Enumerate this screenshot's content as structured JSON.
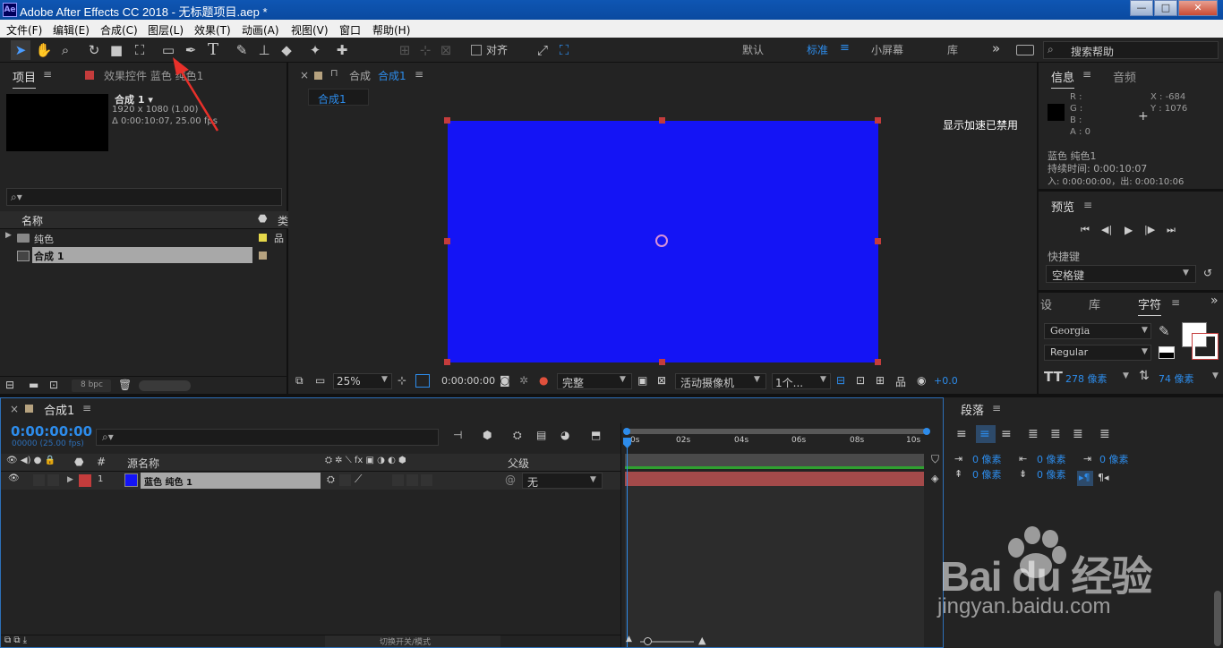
{
  "title": {
    "app_icon": "Ae",
    "text": "Adobe After Effects CC 2018 - 无标题项目.aep *",
    "min": "—",
    "max": "□",
    "close": "✕"
  },
  "menu": [
    "文件(F)",
    "编辑(E)",
    "合成(C)",
    "图层(L)",
    "效果(T)",
    "动画(A)",
    "视图(V)",
    "窗口",
    "帮助(H)"
  ],
  "toolbar": {
    "snap_label": "对齐",
    "workspaces": [
      "默认",
      "标准",
      "小屏幕",
      "库"
    ],
    "more": "»",
    "search_placeholder": "搜索帮助",
    "active_workspace_menu": "≡"
  },
  "project": {
    "tab_project": "项目",
    "tab_menu": "≡",
    "tab_effects": "效果控件 蓝色 纯色1",
    "comp_name": "合成 1 ▾",
    "comp_res": "1920 x 1080 (1.00)",
    "comp_dur": "Δ 0:00:10:07, 25.00 fps",
    "search_icon": "⌕▾",
    "col_name": "名称",
    "col_type": "类",
    "items": [
      {
        "name": "纯色",
        "color": "#e6d84a",
        "type": "folder"
      },
      {
        "name": "合成 1",
        "color": "#b6a27f",
        "type": "comp"
      }
    ],
    "bpc": "8 bpc"
  },
  "comp": {
    "tab_close": "×",
    "tab_lock": "🔒",
    "tab_label": "合成",
    "tab_name": "合成1",
    "tab_menu": "≡",
    "subtab": "合成1",
    "gpu_msg": "显示加速已禁用",
    "zoom": "25%",
    "timecode": "0:00:00:00",
    "quality": "完整",
    "camera": "活动摄像机",
    "views": "1个...",
    "exposure": "+0.0",
    "solid_color": "#1414f5"
  },
  "info": {
    "tab_info": "信息",
    "tab_audio": "音频",
    "menu": "≡",
    "r": "R :",
    "g": "G :",
    "b": "B :",
    "a": "A : 0",
    "x": "X : -684",
    "y": "Y : 1076",
    "layer": "蓝色 纯色1",
    "duration": "持续时间: 0:00:10:07",
    "inout": "入: 0:00:00:00，出: 0:00:10:06"
  },
  "preview": {
    "title": "预览",
    "menu": "≡",
    "shortcut_label": "快捷键",
    "shortcut_value": "空格键"
  },
  "char": {
    "tab_settings": "设",
    "tab_lib": "库",
    "tab_char": "字符",
    "menu": "≡",
    "more": "»",
    "font": "Georgia",
    "style": "Regular",
    "size": "278 像素",
    "leading": "74 像素"
  },
  "para": {
    "title": "段落",
    "menu": "≡",
    "indent1": "0 像素",
    "indent2": "0 像素",
    "indent3": "0 像素",
    "space1": "0 像素",
    "space2": "0 像素"
  },
  "timeline": {
    "tab_close": "×",
    "tab_name": "合成1",
    "menu": "≡",
    "timecode": "0:00:00:00",
    "frames": "00000 (25.00 fps)",
    "col_source": "源名称",
    "col_parent": "父级",
    "col_num": "#",
    "ticks": [
      "0s",
      "02s",
      "04s",
      "06s",
      "08s",
      "10s"
    ],
    "layer": {
      "num": "1",
      "name": "蓝色 纯色 1",
      "parent": "无"
    },
    "footer": "切换开关/模式"
  },
  "watermark": {
    "brand": "Bai du 经验",
    "url": "jingyan.baidu.com"
  },
  "colors": {
    "accent": "#2d8ceb",
    "solid": "#1414f5",
    "label_red": "#c43c3c",
    "layer_bar": "#a44a4a"
  }
}
